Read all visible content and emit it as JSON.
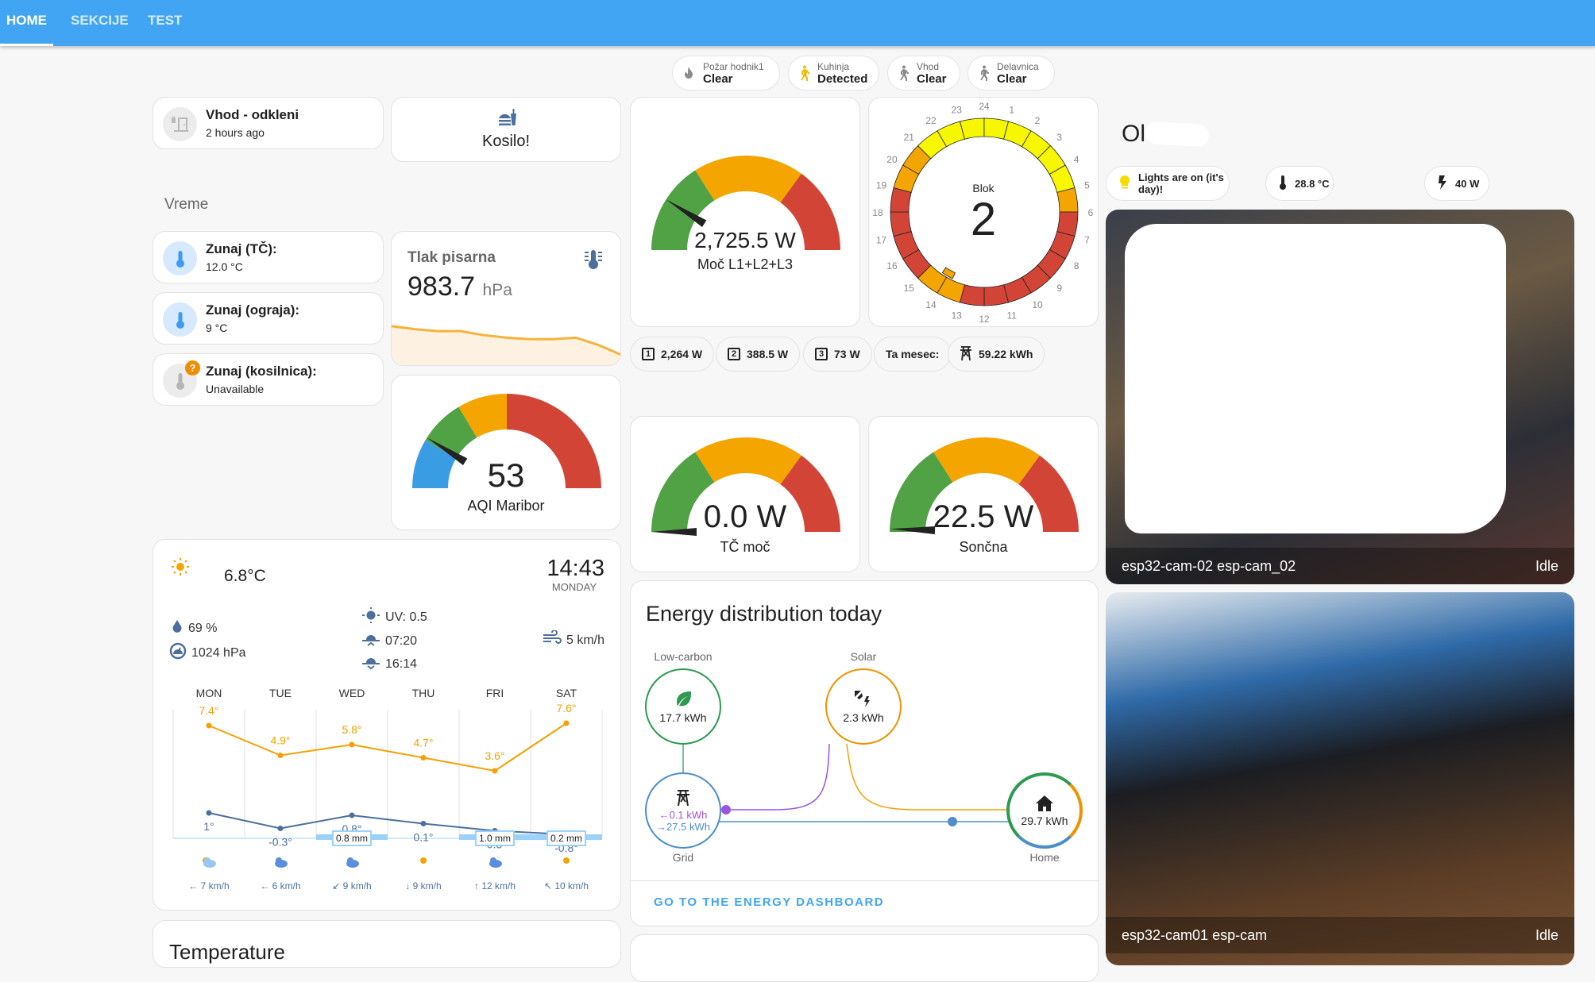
{
  "tabs": [
    {
      "label": "HOME",
      "active": true
    },
    {
      "label": "SEKCIJE"
    },
    {
      "label": "TEST"
    }
  ],
  "header_chips": [
    {
      "icon": "fire-icon",
      "label": "Požar hodnik1",
      "state": "Clear",
      "color": "#8a8a8a"
    },
    {
      "icon": "walk-icon",
      "label": "Kuhinja",
      "state": "Detected",
      "color": "#f5b800"
    },
    {
      "icon": "walk-icon",
      "label": "Vhod",
      "state": "Clear",
      "color": "#8a8a8a"
    },
    {
      "icon": "walk-icon",
      "label": "Delavnica",
      "state": "Clear",
      "color": "#8a8a8a"
    }
  ],
  "lock": {
    "name": "Vhod - odkleni",
    "value": "2 hours ago"
  },
  "kosilo": {
    "label": "Kosilo!"
  },
  "section_title": "Vreme",
  "temps": [
    {
      "name": "Zunaj (TČ):",
      "value": "12.0 °C",
      "available": true
    },
    {
      "name": "Zunaj (ograja):",
      "value": "9 °C",
      "available": true
    },
    {
      "name": "Zunaj (kosilnica):",
      "value": "Unavailable",
      "available": false,
      "badge": "?"
    }
  ],
  "pressure": {
    "title": "Tlak pisarna",
    "value": "983.7",
    "unit": "hPa",
    "trend": [
      0.78,
      0.72,
      0.68,
      0.68,
      0.6,
      0.55,
      0.52,
      0.52,
      0.55,
      0.4,
      0.2
    ]
  },
  "aqi": {
    "value": "53",
    "name": "AQI Maribor",
    "fraction": 0.18
  },
  "power": {
    "value": "2,725.5 W",
    "name": "Moč L1+L2+L3",
    "fraction": 0.18
  },
  "tc": {
    "value": "0.0 W",
    "name": "TČ moč",
    "fraction": 0.0
  },
  "solar_gauge": {
    "value": "22.5 W",
    "name": "Sončna",
    "fraction": 0.01
  },
  "blok": {
    "label": "Blok",
    "value": "2",
    "hours": [
      "24",
      "1",
      "2",
      "3",
      "4",
      "5",
      "6",
      "7",
      "8",
      "9",
      "10",
      "11",
      "12",
      "13",
      "14",
      "15",
      "16",
      "17",
      "18",
      "19",
      "20",
      "21",
      "22",
      "23"
    ],
    "colors": [
      "#f7f700",
      "#f7f700",
      "#f7f700",
      "#f7f700",
      "#f7f700",
      "#f7f700",
      "#f5a500",
      "#d24536",
      "#d24536",
      "#d24536",
      "#d24536",
      "#d24536",
      "#d24536",
      "#d24536",
      "#f5a500",
      "#f5a500",
      "#d24536",
      "#d24536",
      "#d24536",
      "#d24536",
      "#f5a500",
      "#f5a500",
      "#f7f700",
      "#f7f700"
    ]
  },
  "phase_chips": [
    {
      "icon": "numeric-1-box-icon",
      "num": "1",
      "value": "2,264 W"
    },
    {
      "icon": "numeric-2-box-icon",
      "num": "2",
      "value": "388.5 W"
    },
    {
      "icon": "numeric-3-box-icon",
      "num": "3",
      "value": "73 W"
    },
    {
      "label": "Ta mesec:"
    },
    {
      "icon": "transmission-tower-icon",
      "value": "59.22 kWh"
    }
  ],
  "weather": {
    "temp": "6.8°C",
    "time": "14:43",
    "day": "MONDAY",
    "humidity": "69 %",
    "pressure": "1024 hPa",
    "uv": "UV: 0.5",
    "sunrise": "07:20",
    "sunset": "16:14",
    "wind": "5 km/h",
    "forecast": {
      "days": [
        "MON",
        "TUE",
        "WED",
        "THU",
        "FRI",
        "SAT"
      ],
      "high": [
        7.4,
        4.9,
        5.8,
        4.7,
        3.6,
        7.6
      ],
      "high_labels": [
        "7.4°",
        "4.9°",
        "5.8°",
        "4.7°",
        "3.6°",
        "7.6°"
      ],
      "low": [
        1,
        -0.3,
        0.8,
        0.1,
        -0.5,
        -0.8
      ],
      "low_labels": [
        "1°",
        "-0.3°",
        "0.8°",
        "0.1°",
        "-0.5°",
        "-0.8°"
      ],
      "precip": [
        "",
        "",
        "0.8 mm",
        "",
        "1.0 mm",
        "0.2 mm"
      ],
      "conditions": [
        "partly-cloudy",
        "cloudy-snow",
        "cloudy-snow",
        "sunny",
        "rainy",
        "sunny"
      ],
      "wind": [
        {
          "dir": "←",
          "speed": "7",
          "unit": "km/h"
        },
        {
          "dir": "←",
          "speed": "6",
          "unit": "km/h"
        },
        {
          "dir": "↙",
          "speed": "9",
          "unit": "km/h"
        },
        {
          "dir": "↓",
          "speed": "9",
          "unit": "km/h"
        },
        {
          "dir": "↑",
          "speed": "12",
          "unit": "km/h"
        },
        {
          "dir": "↖",
          "speed": "10",
          "unit": "km/h"
        }
      ]
    }
  },
  "energy": {
    "title": "Energy distribution today",
    "low_carbon": {
      "label": "Low-carbon",
      "value": "17.7 kWh"
    },
    "solar": {
      "label": "Solar",
      "value": "2.3 kWh"
    },
    "grid": {
      "label": "Grid",
      "out": "←0.1 kWh",
      "in": "→27.5 kWh"
    },
    "home": {
      "label": "Home",
      "value": "29.7 kWh"
    },
    "link": "GO TO THE ENERGY DASHBOARD"
  },
  "next_card": {
    "title": "Temperature"
  },
  "room": {
    "title": "Ol",
    "chips": [
      {
        "icon": "lightbulb-icon",
        "label": "Lights are on (it's day)!"
      },
      {
        "icon": "thermometer-icon",
        "label": "28.8 °C"
      },
      {
        "icon": "flash-icon",
        "label": "40 W"
      }
    ]
  },
  "cameras": [
    {
      "name": "esp32-cam-02 esp-cam_02",
      "state": "Idle"
    },
    {
      "name": "esp32-cam01 esp-cam",
      "state": "Idle"
    }
  ]
}
